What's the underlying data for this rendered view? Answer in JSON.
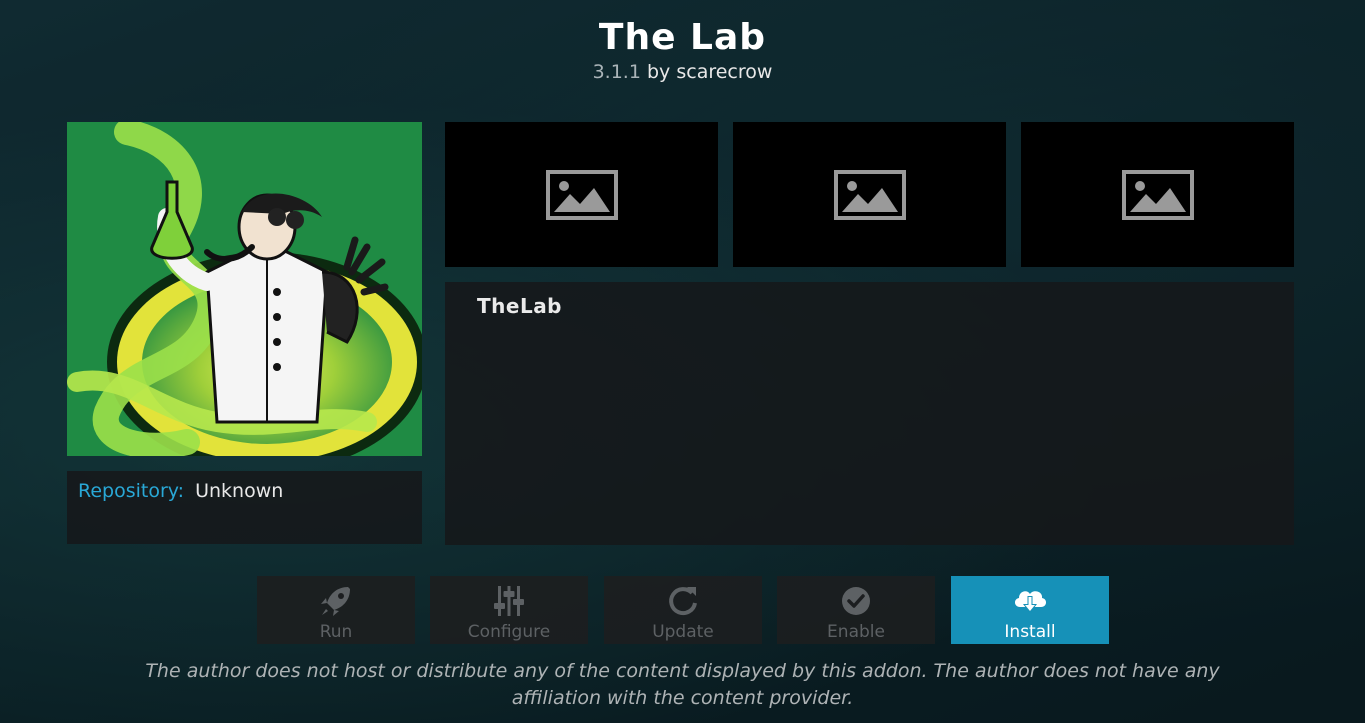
{
  "addon": {
    "title": "The Lab",
    "version": "3.1.1",
    "author_prefix": "by",
    "author": "scarecrow"
  },
  "repository": {
    "label": "Repository:",
    "value": "Unknown"
  },
  "screenshots": [
    {
      "icon": "image-placeholder-icon"
    },
    {
      "icon": "image-placeholder-icon"
    },
    {
      "icon": "image-placeholder-icon"
    }
  ],
  "description": "TheLab",
  "actions": [
    {
      "label": "Run",
      "icon": "rocket-icon",
      "enabled": false
    },
    {
      "label": "Configure",
      "icon": "sliders-icon",
      "enabled": false
    },
    {
      "label": "Update",
      "icon": "refresh-icon",
      "enabled": false
    },
    {
      "label": "Enable",
      "icon": "checkmark-icon",
      "enabled": false
    },
    {
      "label": "Install",
      "icon": "cloud-download-icon",
      "enabled": true,
      "selected": true
    }
  ],
  "disclaimer": "The author does not host or distribute any of the content displayed by this addon. The author does not have any affiliation with the content provider.",
  "colors": {
    "accent": "#1691b8",
    "repository_label": "#29a8d6",
    "disabled_text": "#5d6164"
  }
}
